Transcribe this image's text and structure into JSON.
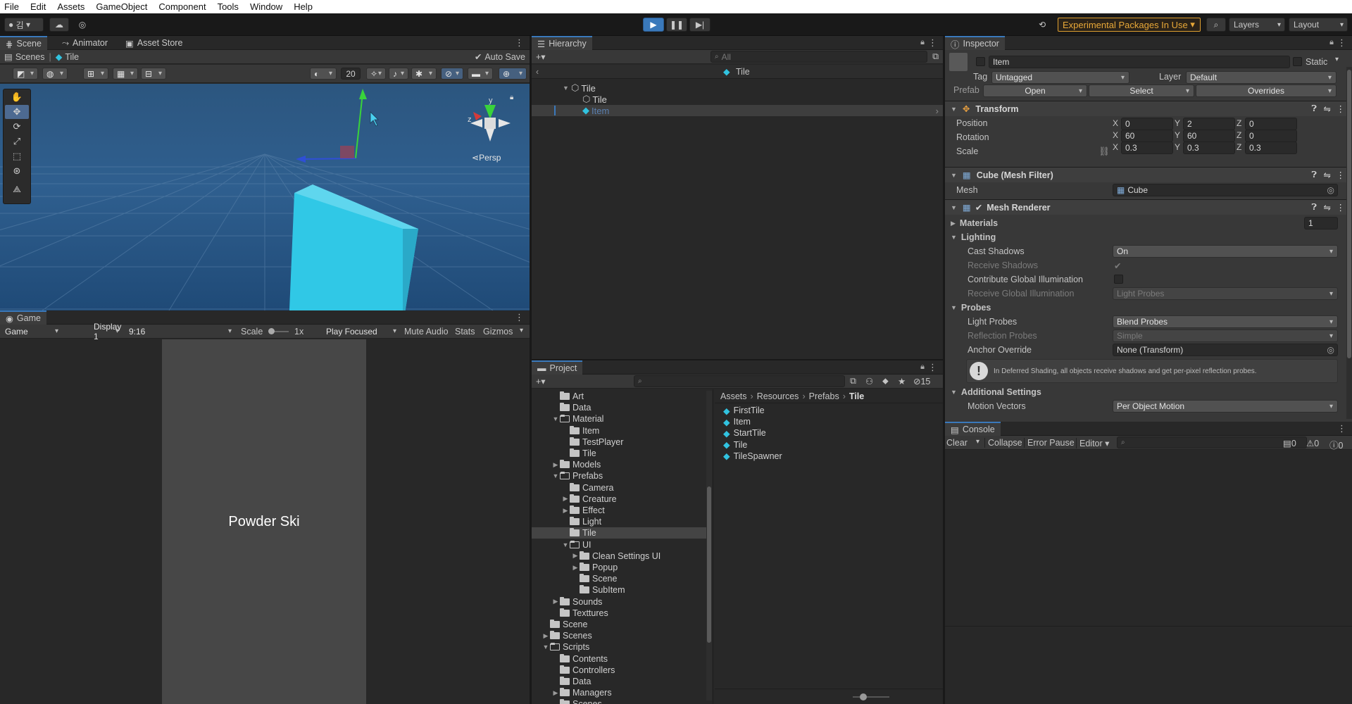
{
  "menu": [
    "File",
    "Edit",
    "Assets",
    "GameObject",
    "Component",
    "Tools",
    "Window",
    "Help"
  ],
  "toolbar": {
    "account_label": "김",
    "experimental": "Experimental Packages In Use",
    "layers": "Layers",
    "layout": "Layout"
  },
  "scene_panel": {
    "tabs": [
      "Scene",
      "Animator",
      "Asset Store"
    ],
    "breadcrumb": [
      "Scenes",
      "Tile"
    ],
    "auto_save": "Auto Save",
    "zoom_value": "20",
    "persp_label": "Persp",
    "gizmo_axis_y": "y"
  },
  "game_panel": {
    "tab": "Game",
    "view_dd": "Game",
    "display_dd": "Display 1",
    "aspect_dd": "9:16",
    "scale_label": "Scale",
    "scale_value": "1x",
    "play_focused": "Play Focused",
    "mute_audio": "Mute Audio",
    "stats": "Stats",
    "gizmos": "Gizmos",
    "game_title": "Powder Ski"
  },
  "hierarchy": {
    "tab": "Hierarchy",
    "search_placeholder": "All",
    "prefab_header": "Tile",
    "rows": [
      "Tile",
      "Tile",
      "Item"
    ]
  },
  "project": {
    "tab": "Project",
    "breadcrumb": [
      "Assets",
      "Resources",
      "Prefabs",
      "Tile"
    ],
    "hidden_count": "15",
    "tree": [
      {
        "label": "Art",
        "depth": 1,
        "arrow": ""
      },
      {
        "label": "Data",
        "depth": 1,
        "arrow": ""
      },
      {
        "label": "Material",
        "depth": 1,
        "arrow": "▼"
      },
      {
        "label": "Item",
        "depth": 2,
        "arrow": ""
      },
      {
        "label": "TestPlayer",
        "depth": 2,
        "arrow": ""
      },
      {
        "label": "Tile",
        "depth": 2,
        "arrow": ""
      },
      {
        "label": "Models",
        "depth": 1,
        "arrow": "▶"
      },
      {
        "label": "Prefabs",
        "depth": 1,
        "arrow": "▼"
      },
      {
        "label": "Camera",
        "depth": 2,
        "arrow": ""
      },
      {
        "label": "Creature",
        "depth": 2,
        "arrow": "▶"
      },
      {
        "label": "Effect",
        "depth": 2,
        "arrow": "▶"
      },
      {
        "label": "Light",
        "depth": 2,
        "arrow": ""
      },
      {
        "label": "Tile",
        "depth": 2,
        "arrow": "",
        "selected": true
      },
      {
        "label": "UI",
        "depth": 2,
        "arrow": "▼"
      },
      {
        "label": "Clean Settings UI",
        "depth": 3,
        "arrow": "▶"
      },
      {
        "label": "Popup",
        "depth": 3,
        "arrow": "▶"
      },
      {
        "label": "Scene",
        "depth": 3,
        "arrow": ""
      },
      {
        "label": "SubItem",
        "depth": 3,
        "arrow": ""
      },
      {
        "label": "Sounds",
        "depth": 1,
        "arrow": "▶"
      },
      {
        "label": "Texttures",
        "depth": 1,
        "arrow": ""
      },
      {
        "label": "Scene",
        "depth": 0,
        "arrow": ""
      },
      {
        "label": "Scenes",
        "depth": 0,
        "arrow": "▶"
      },
      {
        "label": "Scripts",
        "depth": 0,
        "arrow": "▼"
      },
      {
        "label": "Contents",
        "depth": 1,
        "arrow": ""
      },
      {
        "label": "Controllers",
        "depth": 1,
        "arrow": ""
      },
      {
        "label": "Data",
        "depth": 1,
        "arrow": ""
      },
      {
        "label": "Managers",
        "depth": 1,
        "arrow": "▶"
      },
      {
        "label": "Scenes",
        "depth": 1,
        "arrow": ""
      }
    ],
    "assets": [
      "FirstTile",
      "Item",
      "StartTile",
      "Tile",
      "TileSpawner"
    ]
  },
  "inspector": {
    "tab": "Inspector",
    "object_name": "Item",
    "static_label": "Static",
    "tag_label": "Tag",
    "tag_value": "Untagged",
    "layer_label": "Layer",
    "layer_value": "Default",
    "prefab_label": "Prefab",
    "prefab_open": "Open",
    "prefab_select": "Select",
    "prefab_overrides": "Overrides",
    "transform": {
      "title": "Transform",
      "position_label": "Position",
      "position": [
        "0",
        "2",
        "0"
      ],
      "rotation_label": "Rotation",
      "rotation": [
        "60",
        "60",
        "0"
      ],
      "scale_label": "Scale",
      "scale": [
        "0.3",
        "0.3",
        "0.3"
      ],
      "axes": [
        "X",
        "Y",
        "Z"
      ]
    },
    "mesh_filter": {
      "title": "Cube (Mesh Filter)",
      "mesh_label": "Mesh",
      "mesh_value": "Cube"
    },
    "mesh_renderer": {
      "title": "Mesh Renderer",
      "materials_label": "Materials",
      "materials_count": "1",
      "lighting_label": "Lighting",
      "cast_shadows_label": "Cast Shadows",
      "cast_shadows_value": "On",
      "receive_shadows_label": "Receive Shadows",
      "contribute_gi_label": "Contribute Global Illumination",
      "receive_gi_label": "Receive Global Illumination",
      "receive_gi_value": "Light Probes",
      "probes_label": "Probes",
      "light_probes_label": "Light Probes",
      "light_probes_value": "Blend Probes",
      "reflection_probes_label": "Reflection Probes",
      "reflection_probes_value": "Simple",
      "anchor_override_label": "Anchor Override",
      "anchor_override_value": "None (Transform)",
      "info_text": "In Deferred Shading, all objects receive shadows and get per-pixel reflection probes.",
      "additional_label": "Additional Settings",
      "motion_vectors_label": "Motion Vectors",
      "motion_vectors_value": "Per Object Motion"
    }
  },
  "console": {
    "tab": "Console",
    "clear": "Clear",
    "collapse": "Collapse",
    "error_pause": "Error Pause",
    "editor": "Editor",
    "counts": [
      "0",
      "0",
      "0"
    ]
  },
  "colors": {
    "accent": "#3a79bb",
    "cube": "#31c3e0",
    "scene_sky": "#2f5f8f",
    "warning": "#e8a838"
  }
}
